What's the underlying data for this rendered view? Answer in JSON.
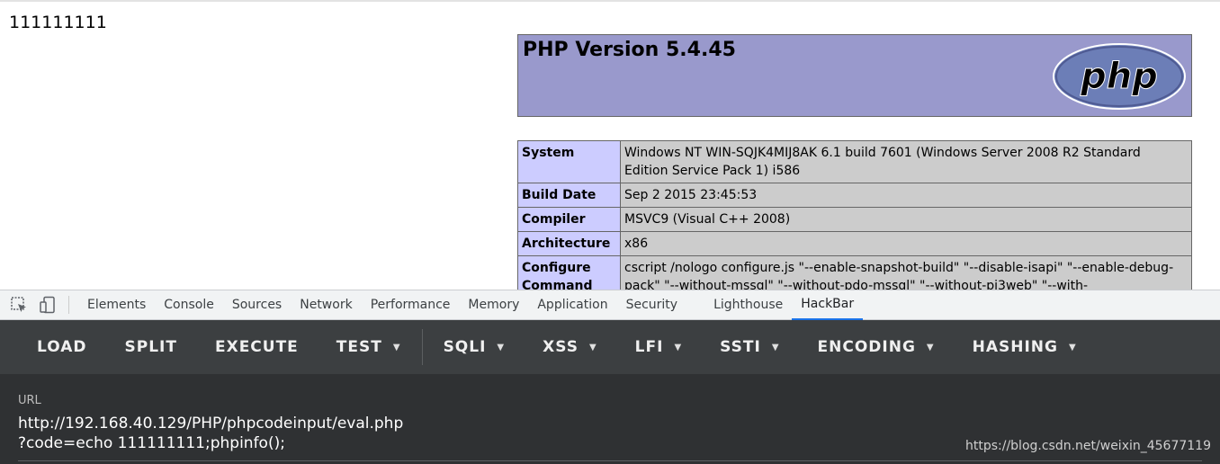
{
  "page": {
    "echo_output": "111111111",
    "php_version_title": "PHP Version 5.4.45",
    "logo_text": "php",
    "info_rows": [
      {
        "key": "System",
        "value": "Windows NT WIN-SQJK4MIJ8AK 6.1 build 7601 (Windows Server 2008 R2 Standard Edition Service Pack 1) i586"
      },
      {
        "key": "Build Date",
        "value": "Sep 2 2015 23:45:53"
      },
      {
        "key": "Compiler",
        "value": "MSVC9 (Visual C++ 2008)"
      },
      {
        "key": "Architecture",
        "value": "x86"
      },
      {
        "key": "Configure Command",
        "value": "cscript /nologo configure.js \"--enable-snapshot-build\" \"--disable-isapi\" \"--enable-debug-pack\" \"--without-mssql\" \"--without-pdo-mssql\" \"--without-pi3web\" \"--with-"
      }
    ]
  },
  "devtools": {
    "icons": [
      "inspect-element-icon",
      "device-toolbar-icon"
    ],
    "tabs": [
      "Elements",
      "Console",
      "Sources",
      "Network",
      "Performance",
      "Memory",
      "Application",
      "Security",
      "Lighthouse",
      "HackBar"
    ],
    "active_tab": "HackBar"
  },
  "hackbar": {
    "buttons": [
      {
        "label": "LOAD",
        "dropdown": false
      },
      {
        "label": "SPLIT",
        "dropdown": false
      },
      {
        "label": "EXECUTE",
        "dropdown": false
      },
      {
        "label": "TEST",
        "dropdown": true
      },
      {
        "label": "SQLI",
        "dropdown": true
      },
      {
        "label": "XSS",
        "dropdown": true
      },
      {
        "label": "LFI",
        "dropdown": true
      },
      {
        "label": "SSTI",
        "dropdown": true
      },
      {
        "label": "ENCODING",
        "dropdown": true
      },
      {
        "label": "HASHING",
        "dropdown": true
      }
    ],
    "url_label": "URL",
    "url_value": "http://192.168.40.129/PHP/phpcodeinput/eval.php\n?code=echo 111111111;phpinfo();"
  },
  "watermark": "https://blog.csdn.net/weixin_45677119",
  "colors": {
    "php_header_bg": "#9999cc",
    "info_key_bg": "#ccccff",
    "info_value_bg": "#cccccc",
    "hackbar_bg": "#3c3f41",
    "active_tab_accent": "#1a73e8"
  }
}
